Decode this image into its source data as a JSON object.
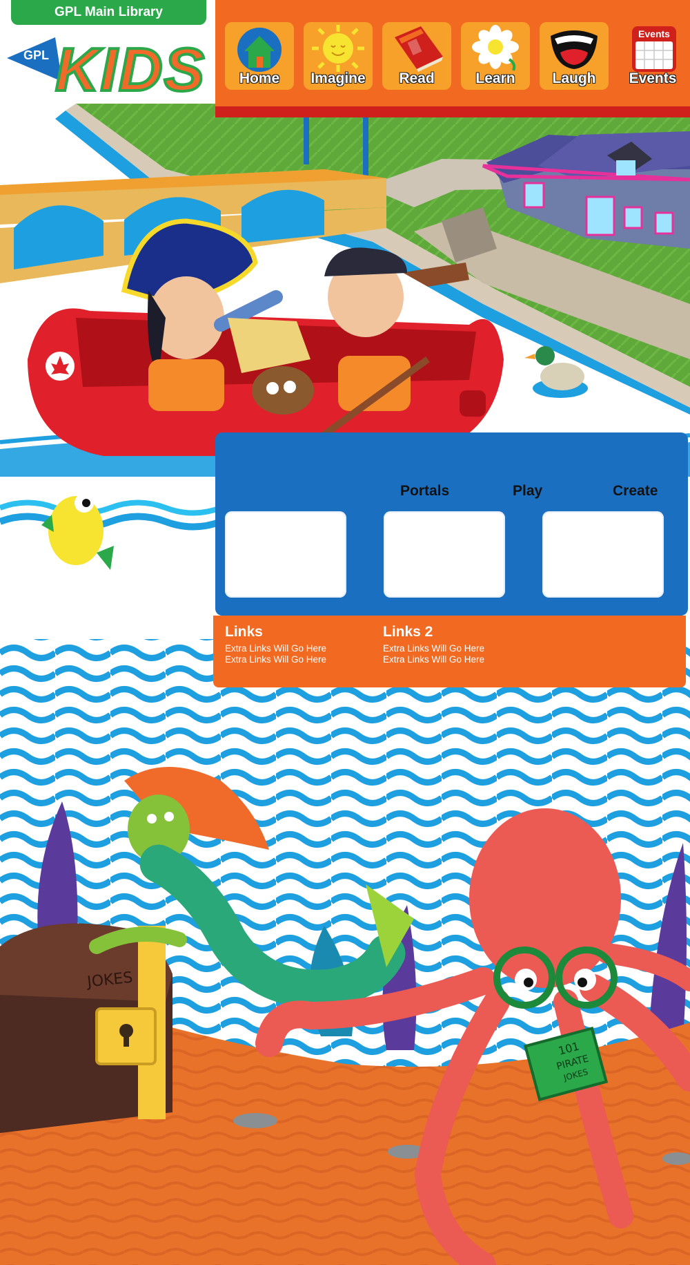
{
  "header": {
    "main_library_label": "GPL Main Library",
    "logo_gpl": "GPL",
    "logo_kids": "KIDS"
  },
  "nav": {
    "items": [
      {
        "label": "Home",
        "icon": "house-icon"
      },
      {
        "label": "Imagine",
        "icon": "sun-icon"
      },
      {
        "label": "Read",
        "icon": "book-icon"
      },
      {
        "label": "Learn",
        "icon": "flower-icon"
      },
      {
        "label": "Laugh",
        "icon": "mouth-icon"
      },
      {
        "label": "Events",
        "icon": "calendar-icon",
        "icon_text": "Events"
      }
    ]
  },
  "portals": {
    "headings": [
      "Portals",
      "Play",
      "Create"
    ]
  },
  "links": {
    "columns": [
      {
        "title": "Links",
        "items": [
          "Extra Links Will Go Here",
          "Extra Links Will Go Here"
        ]
      },
      {
        "title": "Links 2",
        "items": [
          "Extra Links Will Go Here",
          "Extra Links Will Go Here"
        ]
      }
    ]
  },
  "scene": {
    "chest_label": "JOKES",
    "book_label_1": "101",
    "book_label_2": "PIRATE",
    "book_label_3": "JOKES"
  },
  "colors": {
    "nav_orange": "#f26a21",
    "nav_tile": "#f7a12a",
    "panel_blue": "#1b6fc1",
    "library_green": "#2aa84a",
    "water_blue": "#1e9fe0",
    "sand_orange": "#e8722a"
  }
}
